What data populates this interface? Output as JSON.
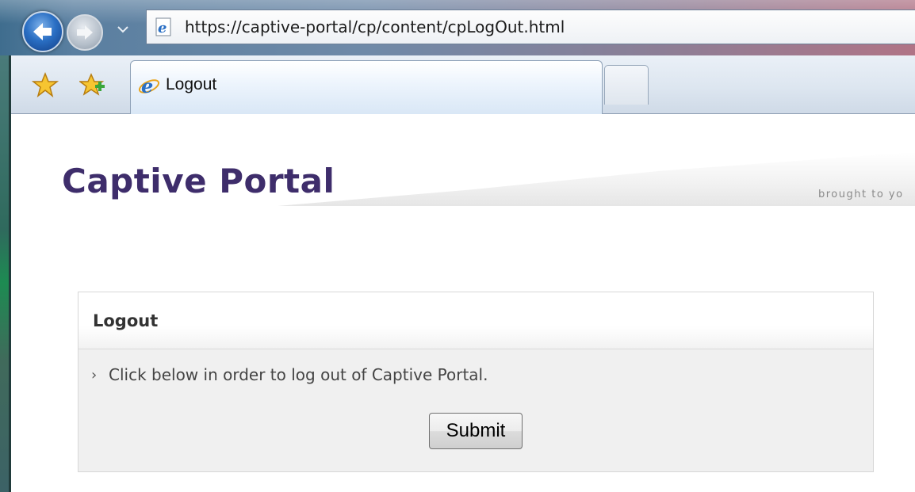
{
  "browser": {
    "address_url": "https://captive-portal/cp/content/cpLogOut.html",
    "tab_title": "Logout"
  },
  "page": {
    "title": "Captive Portal",
    "tagline": "brought to yo",
    "panel": {
      "heading": "Logout",
      "chevron": "›",
      "message": "Click below in order to log out of Captive Portal.",
      "submit_label": "Submit"
    }
  },
  "icons": {
    "back": "back-arrow-icon",
    "forward": "forward-arrow-icon",
    "dropdown": "chevron-down-icon",
    "page": "ie-page-icon",
    "favorites": "favorites-star-icon",
    "add_favorites": "add-favorites-icon",
    "tab": "ie-logo-icon"
  },
  "colors": {
    "title": "#3e2d6b",
    "panel_bg": "#f0f0f0"
  }
}
